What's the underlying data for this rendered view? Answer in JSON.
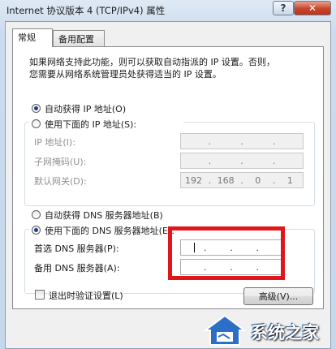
{
  "window": {
    "title": "Internet 协议版本 4 (TCP/IPv4) 属性",
    "help_label": "?",
    "close_label": "✕"
  },
  "tabs": [
    {
      "label": "常规",
      "active": true
    },
    {
      "label": "备用配置",
      "active": false
    }
  ],
  "description": [
    "如果网络支持此功能，则可以获取自动指派的 IP 设置。否则，",
    "您需要从网络系统管理员处获得适当的 IP 设置。"
  ],
  "ip_section": {
    "auto_label": "自动获得 IP 地址(O)",
    "auto_selected": true,
    "manual_label": "使用下面的 IP 地址(S):",
    "manual_selected": false,
    "fields": [
      {
        "label": "IP 地址(I):",
        "octets": [
          "",
          "",
          "",
          ""
        ]
      },
      {
        "label": "子网掩码(U):",
        "octets": [
          "",
          "",
          "",
          ""
        ]
      },
      {
        "label": "默认网关(D):",
        "octets": [
          "192",
          "168",
          "0",
          "1"
        ]
      }
    ]
  },
  "dns_section": {
    "auto_label": "自动获得 DNS 服务器地址(B)",
    "auto_selected": false,
    "manual_label": "使用下面的 DNS 服务器地址(E):",
    "manual_selected": true,
    "fields": [
      {
        "label": "首选 DNS 服务器(P):",
        "octets": [
          "",
          "",
          "",
          ""
        ]
      },
      {
        "label": "备用 DNS 服务器(A):",
        "octets": [
          "",
          "",
          "",
          ""
        ]
      }
    ]
  },
  "validate_label": "退出时验证设置(L)",
  "validate_checked": false,
  "advanced_label": "高级(V)...",
  "watermark": {
    "text": "系统之家"
  },
  "colors": {
    "highlight": "#e0161b",
    "close_button": "#c7452a"
  }
}
